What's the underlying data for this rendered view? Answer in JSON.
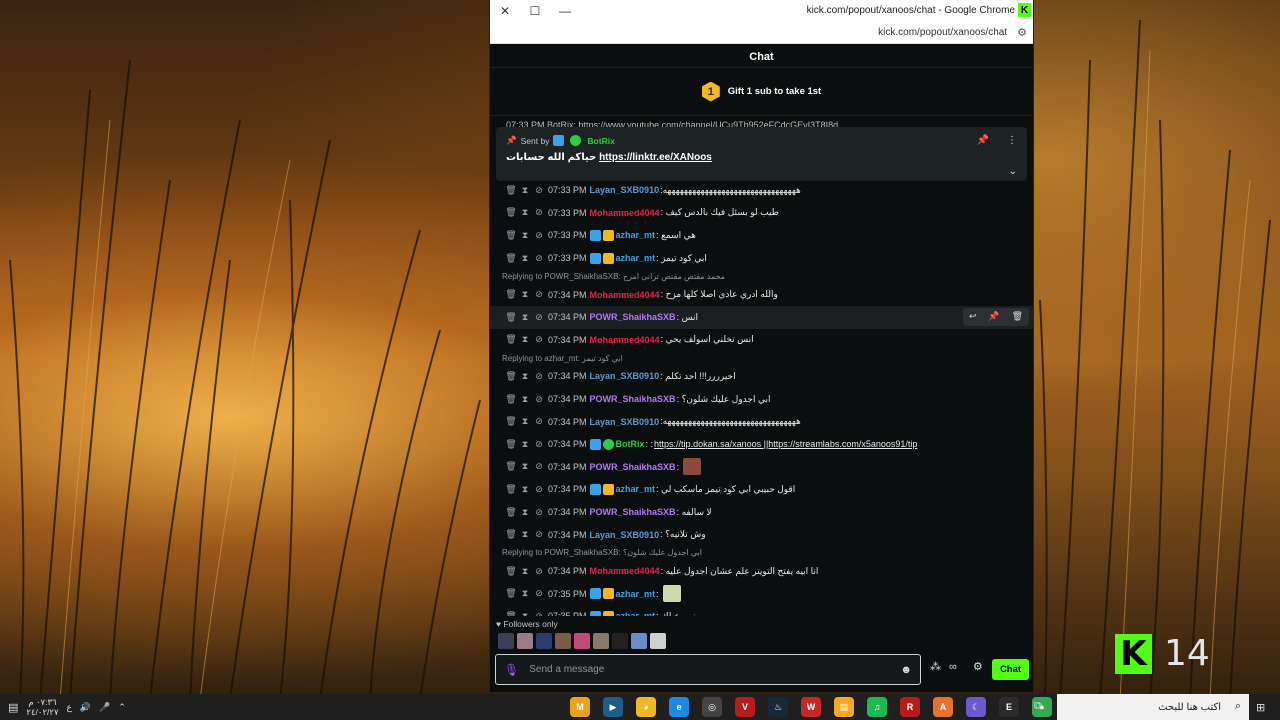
{
  "window": {
    "title": "kick.com/popout/xanoos/chat - Google Chrome",
    "url": "kick.com/popout/xanoos/chat"
  },
  "chat": {
    "header": "Chat",
    "gift_rank": "1",
    "gift_text": "Gift 1 sub to take 1st",
    "cut_line": "07:33 PM  BotRix: https://www.youtube.com/channel/UCu9Tb952eFCdcGEvI3T8I8d",
    "pinned": {
      "sent_by": "Sent by",
      "user": "BotRix",
      "prefix": "حياكم الله حسابات",
      "link": "https://linktr.ee/XANoos"
    },
    "messages": [
      {
        "reply": "",
        "time": "07:33 PM",
        "badges": [],
        "user": "Layan_SXB0910",
        "color": "#5b9bd5",
        "text": ":ههههههههههههههههههههههههههههههههه",
        "link": ""
      },
      {
        "reply": "",
        "time": "07:33 PM",
        "badges": [],
        "user": "Mohammed4044",
        "color": "#e2254a",
        "text": ": طيب لو بسئل فيك بالدس كيف",
        "link": ""
      },
      {
        "reply": "",
        "time": "07:33 PM",
        "badges": [
          "blue",
          "gold"
        ],
        "user": "azhar_mt",
        "color": "#3aa2e6",
        "text": ": هي اسمع",
        "link": ""
      },
      {
        "reply": "",
        "time": "07:33 PM",
        "badges": [
          "blue",
          "gold"
        ],
        "user": "azhar_mt",
        "color": "#3aa2e6",
        "text": ": ابي كود تيمز",
        "link": ""
      },
      {
        "reply": "Replying to POWR_ShaikhaSXB: محمد مقتص مقتص ترانی امزح",
        "time": "07:34 PM",
        "badges": [],
        "user": "Mohammed4044",
        "color": "#e2254a",
        "text": ": والله ادري عادي اصلا كلها مزح",
        "link": ""
      },
      {
        "reply": "",
        "time": "07:34 PM",
        "badges": [],
        "user": "POWR_ShaikhaSXB",
        "color": "#b377f5",
        "text": ": انس",
        "link": "",
        "hover": true
      },
      {
        "reply": "",
        "time": "07:34 PM",
        "badges": [],
        "user": "Mohammed4044",
        "color": "#e2254a",
        "text": ": انس تخلني اسولف يحي",
        "link": ""
      },
      {
        "reply": "Replying to azhar_mt: ابي كود تيمز",
        "time": "07:34 PM",
        "badges": [],
        "user": "Layan_SXB0910",
        "color": "#5b9bd5",
        "text": ": اخيرررر!!! احد تكلم",
        "link": ""
      },
      {
        "reply": "",
        "time": "07:34 PM",
        "badges": [],
        "user": "POWR_ShaikhaSXB",
        "color": "#b377f5",
        "text": ": ابي اجدول عليك شلون؟",
        "link": ""
      },
      {
        "reply": "",
        "time": "07:34 PM",
        "badges": [],
        "user": "Layan_SXB0910",
        "color": "#5b9bd5",
        "text": ":ههههههههههههههههههههههههههههههههه",
        "link": ""
      },
      {
        "reply": "",
        "time": "07:34 PM",
        "badges": [
          "blue",
          "green"
        ],
        "user": "BotRix",
        "color": "#2ecc40",
        "text": ": :",
        "link": "https://tip.dokan.sa/xanoos ||https://streamlabs.com/x5anoos91/tip"
      },
      {
        "reply": "",
        "time": "07:34 PM",
        "badges": [],
        "user": "POWR_ShaikhaSXB",
        "color": "#b377f5",
        "text": ":",
        "link": "",
        "thumb": "#8a4b3c"
      },
      {
        "reply": "",
        "time": "07:34 PM",
        "badges": [
          "blue",
          "gold"
        ],
        "user": "azhar_mt",
        "color": "#3aa2e6",
        "text": ": اقول حبيبي ابي كود تيمز ماسكب لي",
        "link": ""
      },
      {
        "reply": "",
        "time": "07:34 PM",
        "badges": [],
        "user": "POWR_ShaikhaSXB",
        "color": "#b377f5",
        "text": ": لا سالفه",
        "link": ""
      },
      {
        "reply": "",
        "time": "07:34 PM",
        "badges": [],
        "user": "Layan_SXB0910",
        "color": "#5b9bd5",
        "text": ": وش تلانيه؟",
        "link": ""
      },
      {
        "reply": "Replying to POWR_ShaikhaSXB: ابي اجدول عليك شلون؟",
        "time": "07:34 PM",
        "badges": [],
        "user": "Mohammed4044",
        "color": "#e2254a",
        "text": ": انا ابيه يفتح التويتر علم عشان اجدول عليه",
        "link": ""
      },
      {
        "reply": "",
        "time": "07:35 PM",
        "badges": [
          "blue",
          "gold"
        ],
        "user": "azhar_mt",
        "color": "#3aa2e6",
        "text": ":",
        "link": "",
        "thumb": "#cdd9b0"
      },
      {
        "reply": "",
        "time": "07:35 PM",
        "badges": [
          "blue",
          "gold"
        ],
        "user": "azhar_mt",
        "color": "#3aa2e6",
        "text": ": من زين عيلك",
        "link": ""
      }
    ],
    "followers_only": "Followers only",
    "input_placeholder": "Send a message",
    "send_label": "Chat"
  },
  "overlay": {
    "viewer_count": "14",
    "logo_letter": "K"
  },
  "taskbar": {
    "clock_time": "٠٧:٣٦ م",
    "clock_date": "٢٤/٠٢/٢٧",
    "lang": "ع",
    "search_placeholder": "اكتب هنا للبحث",
    "apps": [
      {
        "label": "M",
        "color": "#e8a21c"
      },
      {
        "label": "▶",
        "color": "#1b5d8c"
      },
      {
        "label": "◕",
        "color": "#f0b822"
      },
      {
        "label": "e",
        "color": "#1e88e5"
      },
      {
        "label": "◎",
        "color": "#444444"
      },
      {
        "label": "V",
        "color": "#b71c1c"
      },
      {
        "label": "♨",
        "color": "#1b2838"
      },
      {
        "label": "W",
        "color": "#c62828"
      },
      {
        "label": "▤",
        "color": "#f9a825"
      },
      {
        "label": "♫",
        "color": "#1db954"
      },
      {
        "label": "R",
        "color": "#b71c1c"
      },
      {
        "label": "A",
        "color": "#e8712c"
      },
      {
        "label": "☾",
        "color": "#6a5acd"
      },
      {
        "label": "E",
        "color": "#2b2b2b"
      },
      {
        "label": "●",
        "color": "#34a853"
      }
    ]
  }
}
